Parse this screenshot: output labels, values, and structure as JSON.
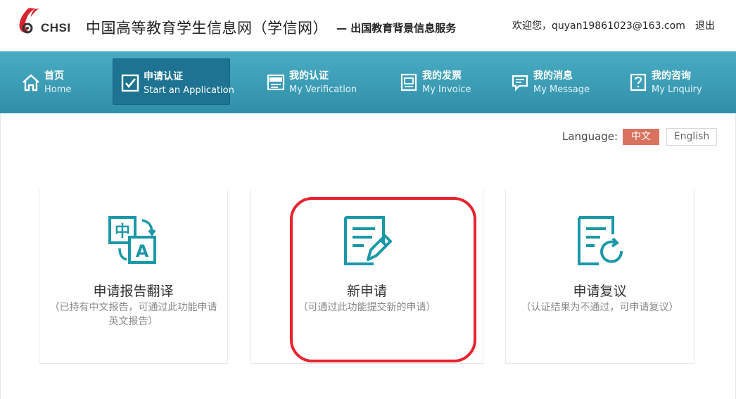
{
  "header": {
    "logo_text": "CHSI",
    "site_title": "中国高等教育学生信息网（学信网）",
    "site_subtitle": "— 出国教育背景信息服务",
    "user_greeting": "欢迎您，quyan19861023@163.com",
    "logout_label": "退出"
  },
  "nav": {
    "items": [
      {
        "cn": "首页",
        "en": "Home",
        "icon": "home-icon"
      },
      {
        "cn": "申请认证",
        "en": "Start an Application",
        "icon": "checkbox-icon",
        "active": true
      },
      {
        "cn": "我的认证",
        "en": "My Verification",
        "icon": "verification-icon"
      },
      {
        "cn": "我的发票",
        "en": "My Invoice",
        "icon": "invoice-icon"
      },
      {
        "cn": "我的消息",
        "en": "My Message",
        "icon": "message-icon"
      },
      {
        "cn": "我的咨询",
        "en": "My Lnquiry",
        "icon": "question-icon"
      }
    ]
  },
  "language": {
    "label": "Language:",
    "zh": "中文",
    "en": "English",
    "selected": "中文"
  },
  "cards": [
    {
      "title": "申请报告翻译",
      "desc_line1": "（已持有中文报告，可通过此功能申请",
      "desc_line2": "英文报告）",
      "icon": "translate-icon"
    },
    {
      "title": "新申请",
      "desc_line1": "（可通过此功能提交新的申请）",
      "icon": "edit-document-icon"
    },
    {
      "title": "申请复议",
      "desc_line1": "（认证结果为不通过，可申请复议）",
      "icon": "document-refresh-icon"
    }
  ],
  "colors": {
    "nav_bg": "#3a9db6",
    "nav_active": "#1d7391",
    "accent_teal": "#1a98a8",
    "lang_active": "#d9725e",
    "highlight": "#e8232f"
  }
}
